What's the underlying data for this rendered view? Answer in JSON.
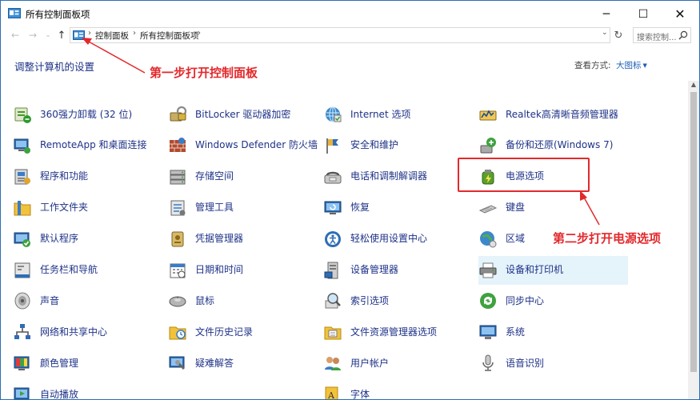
{
  "window": {
    "title": "所有控制面板项"
  },
  "titlebar": {
    "minimize": "─",
    "maximize": "☐",
    "close": "✕"
  },
  "nav": {
    "back": "←",
    "forward": "→",
    "recent": "⌄",
    "up": "↑",
    "address_dropdown": "⌄",
    "refresh": "↻"
  },
  "breadcrumb": [
    "控制面板",
    "所有控制面板项"
  ],
  "breadcrumb_sep": "›",
  "search": {
    "placeholder": "搜索控制..."
  },
  "header": {
    "title": "调整计算机的设置",
    "view_by_label": "查看方式:",
    "view_by_value": "大图标",
    "view_by_caret": "▼"
  },
  "annotations": {
    "step1": "第一步打开控制面板",
    "step2": "第二步打开电源选项"
  },
  "colors": {
    "annotation": "#e3292c",
    "link": "#1e3287",
    "selected_bg": "#e5f3fb"
  },
  "items": [
    {
      "label": "360强力卸载 (32 位)",
      "icon": "uninstall-icon"
    },
    {
      "label": "BitLocker 驱动器加密",
      "icon": "bitlocker-icon"
    },
    {
      "label": "Internet 选项",
      "icon": "internet-options-icon"
    },
    {
      "label": "Realtek高清晰音频管理器",
      "icon": "realtek-audio-icon"
    },
    {
      "label": "RemoteApp 和桌面连接",
      "icon": "remote-desktop-icon"
    },
    {
      "label": "Windows Defender 防火墙",
      "icon": "firewall-icon"
    },
    {
      "label": "安全和维护",
      "icon": "flag-icon"
    },
    {
      "label": "备份和还原(Windows 7)",
      "icon": "backup-icon"
    },
    {
      "label": "程序和功能",
      "icon": "programs-icon"
    },
    {
      "label": "存储空间",
      "icon": "storage-icon"
    },
    {
      "label": "电话和调制解调器",
      "icon": "phone-modem-icon"
    },
    {
      "label": "电源选项",
      "icon": "power-options-icon"
    },
    {
      "label": "工作文件夹",
      "icon": "work-folders-icon"
    },
    {
      "label": "管理工具",
      "icon": "admin-tools-icon"
    },
    {
      "label": "恢复",
      "icon": "recovery-icon"
    },
    {
      "label": "键盘",
      "icon": "keyboard-icon"
    },
    {
      "label": "默认程序",
      "icon": "default-programs-icon"
    },
    {
      "label": "凭据管理器",
      "icon": "credential-icon"
    },
    {
      "label": "轻松使用设置中心",
      "icon": "ease-of-access-icon"
    },
    {
      "label": "区域",
      "icon": "region-icon"
    },
    {
      "label": "任务栏和导航",
      "icon": "taskbar-icon"
    },
    {
      "label": "日期和时间",
      "icon": "calendar-icon"
    },
    {
      "label": "设备管理器",
      "icon": "device-manager-icon"
    },
    {
      "label": "设备和打印机",
      "icon": "printer-icon"
    },
    {
      "label": "声音",
      "icon": "speaker-icon"
    },
    {
      "label": "鼠标",
      "icon": "mouse-icon"
    },
    {
      "label": "索引选项",
      "icon": "indexing-icon"
    },
    {
      "label": "同步中心",
      "icon": "sync-icon"
    },
    {
      "label": "网络和共享中心",
      "icon": "network-icon"
    },
    {
      "label": "文件历史记录",
      "icon": "file-history-icon"
    },
    {
      "label": "文件资源管理器选项",
      "icon": "explorer-options-icon"
    },
    {
      "label": "系统",
      "icon": "system-icon"
    },
    {
      "label": "颜色管理",
      "icon": "color-management-icon"
    },
    {
      "label": "疑难解答",
      "icon": "troubleshoot-icon"
    },
    {
      "label": "用户帐户",
      "icon": "users-icon"
    },
    {
      "label": "语音识别",
      "icon": "microphone-icon"
    },
    {
      "label": "自动播放",
      "icon": "autoplay-icon"
    },
    {
      "label": "",
      "icon": ""
    },
    {
      "label": "字体",
      "icon": "fonts-icon"
    },
    {
      "label": "",
      "icon": ""
    }
  ]
}
